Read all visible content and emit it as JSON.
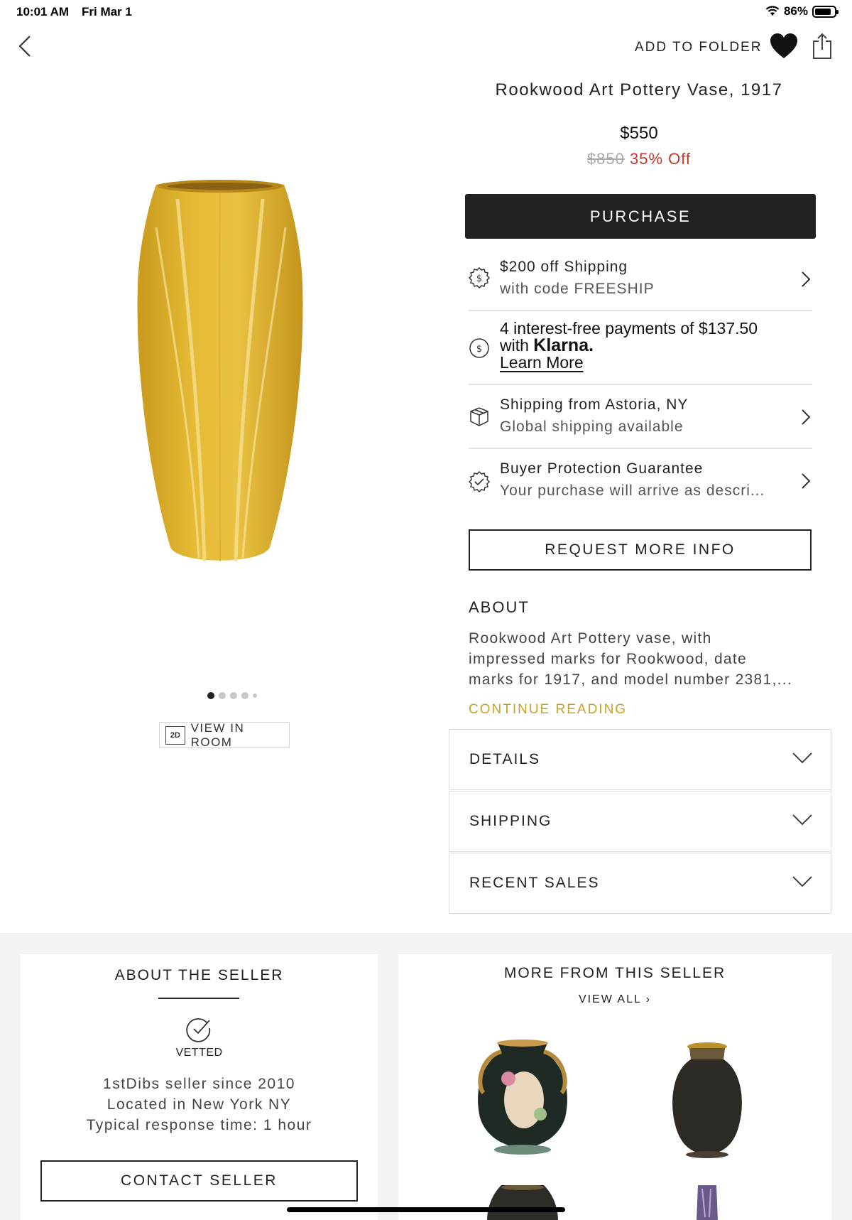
{
  "status_bar": {
    "time": "10:01 AM",
    "date": "Fri Mar 1",
    "battery": "86%",
    "battery_level": 0.86
  },
  "header": {
    "add_to_folder": "ADD TO FOLDER"
  },
  "product": {
    "title": "Rookwood Art Pottery Vase, 1917",
    "price": "$550",
    "original_price": "$850",
    "discount": "35% Off",
    "image_count": 5,
    "active_image_index": 0,
    "view_in_room": "VIEW IN ROOM",
    "view_in_room_icon": "2D"
  },
  "purchase_label": "PURCHASE",
  "info_rows": {
    "shipping_offer": {
      "title": "$200 off Shipping",
      "subtitle": "with code FREESHIP"
    },
    "klarna": {
      "line1": "4 interest-free payments of $137.50",
      "with": "with",
      "brand": "Klarna.",
      "link": "Learn More"
    },
    "shipping_from": {
      "title": "Shipping from Astoria, NY",
      "subtitle": "Global shipping available"
    },
    "protection": {
      "title": "Buyer Protection Guarantee",
      "subtitle": "Your purchase will arrive as descri..."
    }
  },
  "request_more_info": "REQUEST MORE INFO",
  "about": {
    "heading": "ABOUT",
    "lines": [
      "Rookwood Art Pottery vase, with",
      "impressed marks for Rookwood, date",
      "marks for 1917, and model number 2381,..."
    ],
    "continue": "CONTINUE READING"
  },
  "accordions": [
    "DETAILS",
    "SHIPPING",
    "RECENT SALES"
  ],
  "seller": {
    "heading": "ABOUT THE SELLER",
    "vetted": "VETTED",
    "since": "1stDibs seller since 2010",
    "location": "Located in New York NY",
    "response": "Typical response time: 1 hour",
    "contact": "CONTACT SELLER"
  },
  "more_from_seller": {
    "heading": "MORE FROM THIS SELLER",
    "view_all": "VIEW ALL"
  },
  "colors": {
    "accent_gold": "#c9a227",
    "discount_red": "#c0392b",
    "button_dark": "#222222",
    "vase_yellow": "#e0b531"
  }
}
